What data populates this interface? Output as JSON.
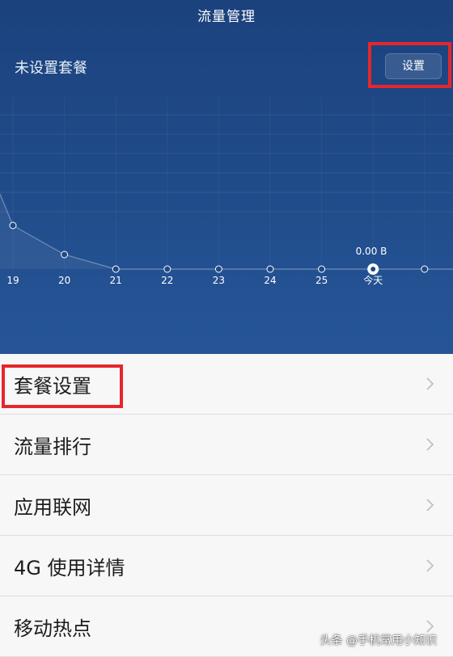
{
  "header": {
    "title": "流量管理",
    "plan_status": "未设置套餐",
    "settings_button": "设置"
  },
  "chart_data": {
    "type": "line",
    "x": [
      "19",
      "20",
      "21",
      "22",
      "23",
      "24",
      "25",
      "今天",
      ""
    ],
    "today_value_label": "0.00 B",
    "grid": true
  },
  "menu": [
    {
      "label": "套餐设置"
    },
    {
      "label": "流量排行"
    },
    {
      "label": "应用联网"
    },
    {
      "label": "4G 使用详情"
    },
    {
      "label": "移动热点"
    }
  ],
  "watermark": "头条 @手机常用小知识"
}
